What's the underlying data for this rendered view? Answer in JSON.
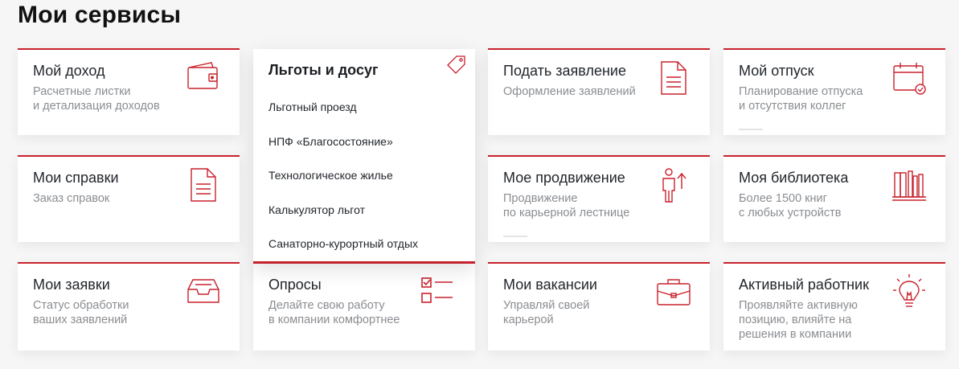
{
  "page": {
    "title": "Мои сервисы"
  },
  "cards": {
    "income": {
      "title": "Мой доход",
      "desc": "Расчетные листки\nи детализация доходов",
      "icon": "wallet-icon"
    },
    "statement": {
      "title": "Подать заявление",
      "desc": "Оформление заявлений",
      "icon": "document-icon"
    },
    "vacation": {
      "title": "Мой отпуск",
      "desc": "Планирование отпуска\nи отсутствия коллег",
      "icon": "calendar-check-icon"
    },
    "references": {
      "title": "Мои справки",
      "desc": "Заказ справок",
      "icon": "document-icon"
    },
    "promotion": {
      "title": "Мое продвижение",
      "desc": "Продвижение\nпо карьерной лестнице",
      "icon": "person-arrow-up-icon"
    },
    "library": {
      "title": "Моя библиотека",
      "desc": "Более 1500 книг\nс любых устройств",
      "icon": "bookshelf-icon"
    },
    "requests": {
      "title": "Мои заявки",
      "desc": "Статус обработки\nваших заявлений",
      "icon": "inbox-tray-icon"
    },
    "surveys": {
      "title": "Опросы",
      "desc": "Делайте свою работу\nв компании комфортнее",
      "icon": "checklist-icon"
    },
    "vacancies": {
      "title": "Мои вакансии",
      "desc": "Управляй своей\nкарьерой",
      "icon": "briefcase-icon"
    },
    "active": {
      "title": "Активный работник",
      "desc": "Проявляйте активную\nпозицию, влияйте на\nрешения в компании",
      "icon": "lightbulb-icon"
    }
  },
  "benefits_menu": {
    "title": "Льготы и досуг",
    "icon": "tag-icon",
    "items": [
      "Льготный проезд",
      "НПФ «Благосостояние»",
      "Технологическое жилье",
      "Калькулятор льгот",
      "Санаторно-курортный отдых"
    ]
  },
  "colors": {
    "accent": "#c9212c",
    "text": "#22262b",
    "muted": "#8a8d91",
    "background": "#f6f6f6"
  }
}
